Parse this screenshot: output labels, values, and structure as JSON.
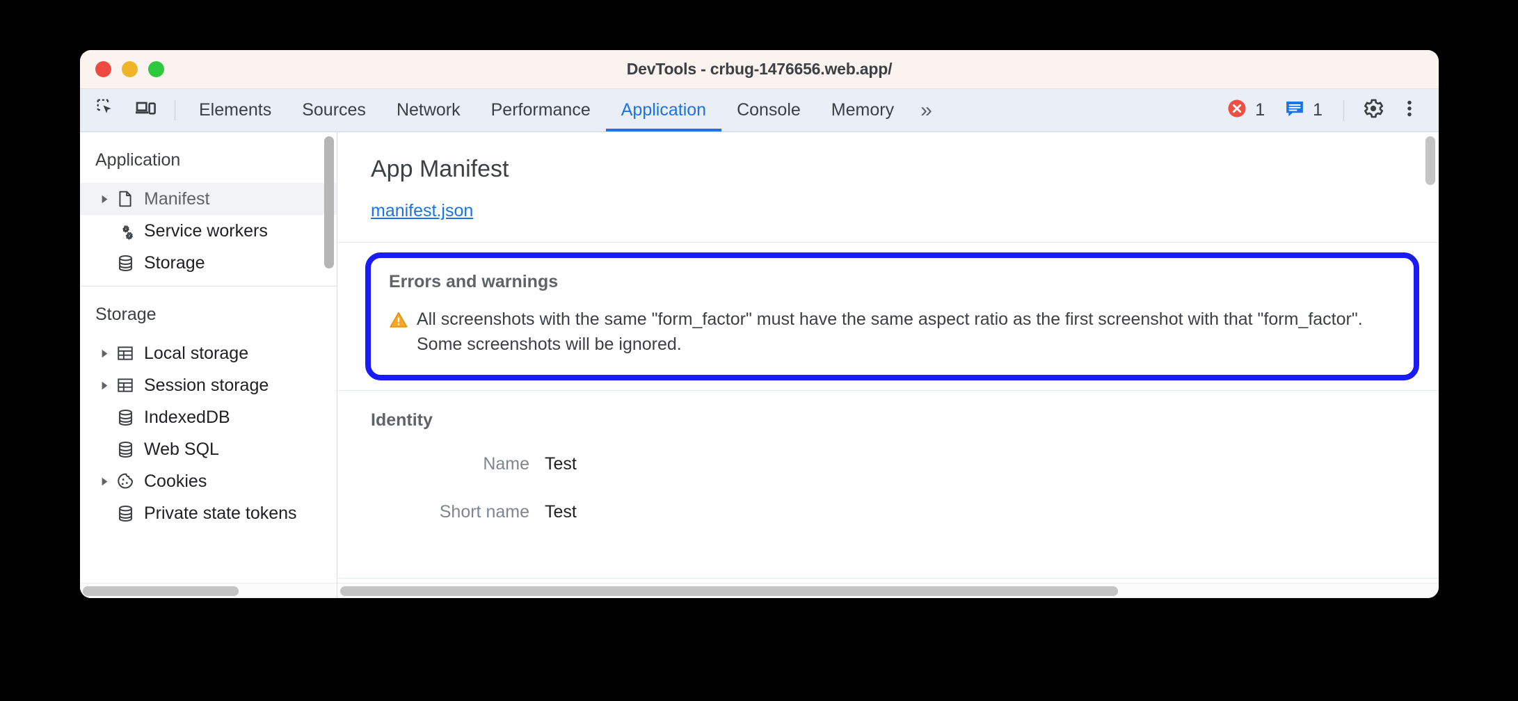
{
  "window": {
    "title": "DevTools - crbug-1476656.web.app/",
    "traffic_lights": [
      {
        "name": "close",
        "color": "#ed4b42"
      },
      {
        "name": "minimize",
        "color": "#f0b429"
      },
      {
        "name": "maximize",
        "color": "#2cc83d"
      }
    ]
  },
  "toolbar": {
    "inspect_icon": "inspect-element-icon",
    "device_icon": "device-toolbar-icon",
    "tabs": [
      {
        "label": "Elements",
        "active": false
      },
      {
        "label": "Sources",
        "active": false
      },
      {
        "label": "Network",
        "active": false
      },
      {
        "label": "Performance",
        "active": false
      },
      {
        "label": "Application",
        "active": true
      },
      {
        "label": "Console",
        "active": false
      },
      {
        "label": "Memory",
        "active": false
      }
    ],
    "more_tabs_label": "»",
    "error_icon": "error-circle-icon",
    "error_count": "1",
    "message_icon": "message-bubble-icon",
    "message_count": "1",
    "settings_icon": "gear-icon",
    "more_icon": "kebab-menu-icon",
    "accent_color": "#1a73e8",
    "error_color": "#ee5044",
    "message_color": "#1a73e8"
  },
  "sidebar": {
    "sections": [
      {
        "title": "Application",
        "items": [
          {
            "label": "Manifest",
            "icon": "document-icon",
            "expandable": true,
            "selected": true
          },
          {
            "label": "Service workers",
            "icon": "gears-icon",
            "expandable": false,
            "selected": false
          },
          {
            "label": "Storage",
            "icon": "database-icon",
            "expandable": false,
            "selected": false
          }
        ]
      },
      {
        "title": "Storage",
        "items": [
          {
            "label": "Local storage",
            "icon": "table-icon",
            "expandable": true,
            "selected": false
          },
          {
            "label": "Session storage",
            "icon": "table-icon",
            "expandable": true,
            "selected": false
          },
          {
            "label": "IndexedDB",
            "icon": "database-icon",
            "expandable": false,
            "selected": false
          },
          {
            "label": "Web SQL",
            "icon": "database-icon",
            "expandable": false,
            "selected": false
          },
          {
            "label": "Cookies",
            "icon": "cookie-icon",
            "expandable": true,
            "selected": false
          },
          {
            "label": "Private state tokens",
            "icon": "database-icon",
            "expandable": false,
            "selected": false
          }
        ]
      }
    ]
  },
  "main": {
    "page_title": "App Manifest",
    "manifest_link": "manifest.json",
    "errors_and_warnings": {
      "heading": "Errors and warnings",
      "warning_icon": "warning-triangle-icon",
      "message": "All screenshots with the same \"form_factor\" must have the same aspect ratio as the first screenshot with that \"form_factor\". Some screenshots will be ignored.",
      "highlight_color": "#1a1afb"
    },
    "identity": {
      "heading": "Identity",
      "fields": [
        {
          "label": "Name",
          "value": "Test"
        },
        {
          "label": "Short name",
          "value": "Test"
        }
      ]
    }
  }
}
